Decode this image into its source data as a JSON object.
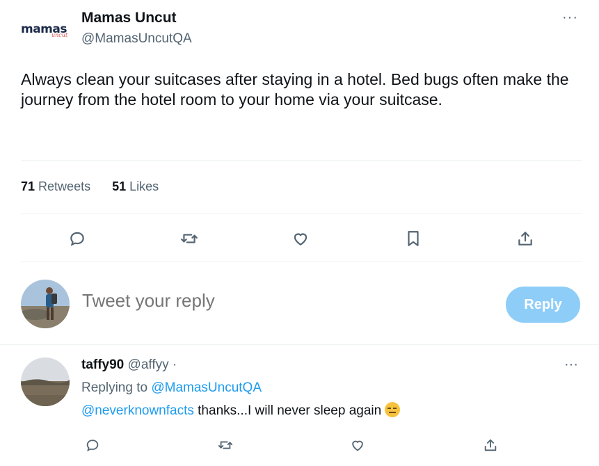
{
  "tweet": {
    "author_name": "Mamas Uncut",
    "author_handle": "@MamasUncutQA",
    "logo_text": "mamas",
    "logo_subtext": "uncut",
    "more_label": "···",
    "text": "Always clean your suitcases after staying in a hotel. Bed bugs often make the journey from the hotel room to your home via your suitcase.",
    "stats": {
      "retweets_count": "71",
      "retweets_label": "Retweets",
      "likes_count": "51",
      "likes_label": "Likes"
    },
    "actions": [
      {
        "name": "reply",
        "icon": "reply-icon"
      },
      {
        "name": "retweet",
        "icon": "retweet-icon"
      },
      {
        "name": "like",
        "icon": "heart-icon"
      },
      {
        "name": "bookmark",
        "icon": "bookmark-icon"
      },
      {
        "name": "share",
        "icon": "share-icon"
      }
    ]
  },
  "reply_box": {
    "placeholder": "Tweet your reply",
    "button_label": "Reply"
  },
  "comment": {
    "name": "taffy90",
    "handle": "@affyy ·",
    "replying_prefix": "Replying to",
    "replying_to": "@MamasUncutQA",
    "mention": "@neverknownfacts",
    "text": " thanks...I will never sleep again",
    "emoji": "expressionless-face",
    "more_label": "···"
  },
  "colors": {
    "accent": "#1d9bf0",
    "reply_button": "#8ecdf8",
    "secondary_text": "#536471",
    "divider": "#eff3f4"
  }
}
